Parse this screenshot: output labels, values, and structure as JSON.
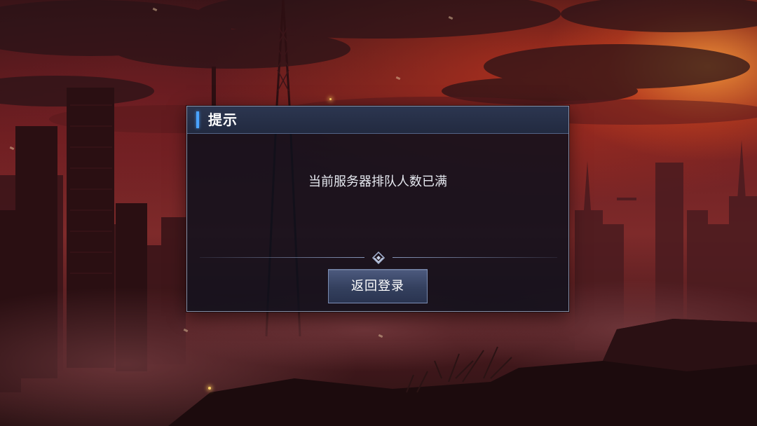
{
  "dialog": {
    "title": "提示",
    "message": "当前服务器排队人数已满",
    "return_button_label": "返回登录"
  },
  "colors": {
    "accent": "#4aa3ff",
    "dialog_bg": "#0e101c",
    "button_bg": "#3a4668",
    "sky": "#7e2a2a"
  },
  "icons": {
    "divider": "diamond-divider-icon"
  }
}
